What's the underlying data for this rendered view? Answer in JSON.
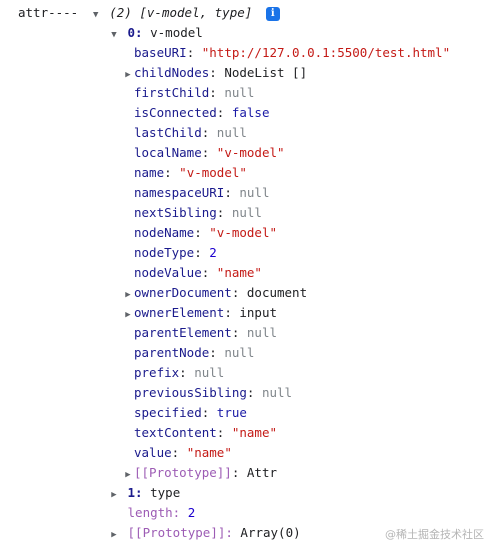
{
  "console": {
    "log_label": "attr----",
    "summary": "(2) [v-model, type]",
    "info_icon": "i",
    "item0": {
      "key": "0:",
      "value": "v-model"
    },
    "props": [
      {
        "key": "baseURI",
        "value": "\"http://127.0.0.1:5500/test.html\""
      },
      {
        "key": "childNodes",
        "value": "NodeList []"
      },
      {
        "key": "firstChild",
        "value": "null"
      },
      {
        "key": "isConnected",
        "value": "false"
      },
      {
        "key": "lastChild",
        "value": "null"
      },
      {
        "key": "localName",
        "value": "\"v-model\""
      },
      {
        "key": "name",
        "value": "\"v-model\""
      },
      {
        "key": "namespaceURI",
        "value": "null"
      },
      {
        "key": "nextSibling",
        "value": "null"
      },
      {
        "key": "nodeName",
        "value": "\"v-model\""
      },
      {
        "key": "nodeType",
        "value": "2"
      },
      {
        "key": "nodeValue",
        "value": "\"name\""
      },
      {
        "key": "ownerDocument",
        "value": "document"
      },
      {
        "key": "ownerElement",
        "value": "input"
      },
      {
        "key": "parentElement",
        "value": "null"
      },
      {
        "key": "parentNode",
        "value": "null"
      },
      {
        "key": "prefix",
        "value": "null"
      },
      {
        "key": "previousSibling",
        "value": "null"
      },
      {
        "key": "specified",
        "value": "true"
      },
      {
        "key": "textContent",
        "value": "\"name\""
      },
      {
        "key": "value",
        "value": "\"name\""
      },
      {
        "key": "[[Prototype]]",
        "value": "Attr"
      }
    ],
    "item1": {
      "key": "1:",
      "value": "type"
    },
    "length": {
      "key": "length:",
      "value": "2"
    },
    "array_proto": {
      "key": "[[Prototype]]:",
      "value": "Array(0)"
    },
    "separator": ":"
  },
  "watermark": "@稀土掘金技术社区"
}
